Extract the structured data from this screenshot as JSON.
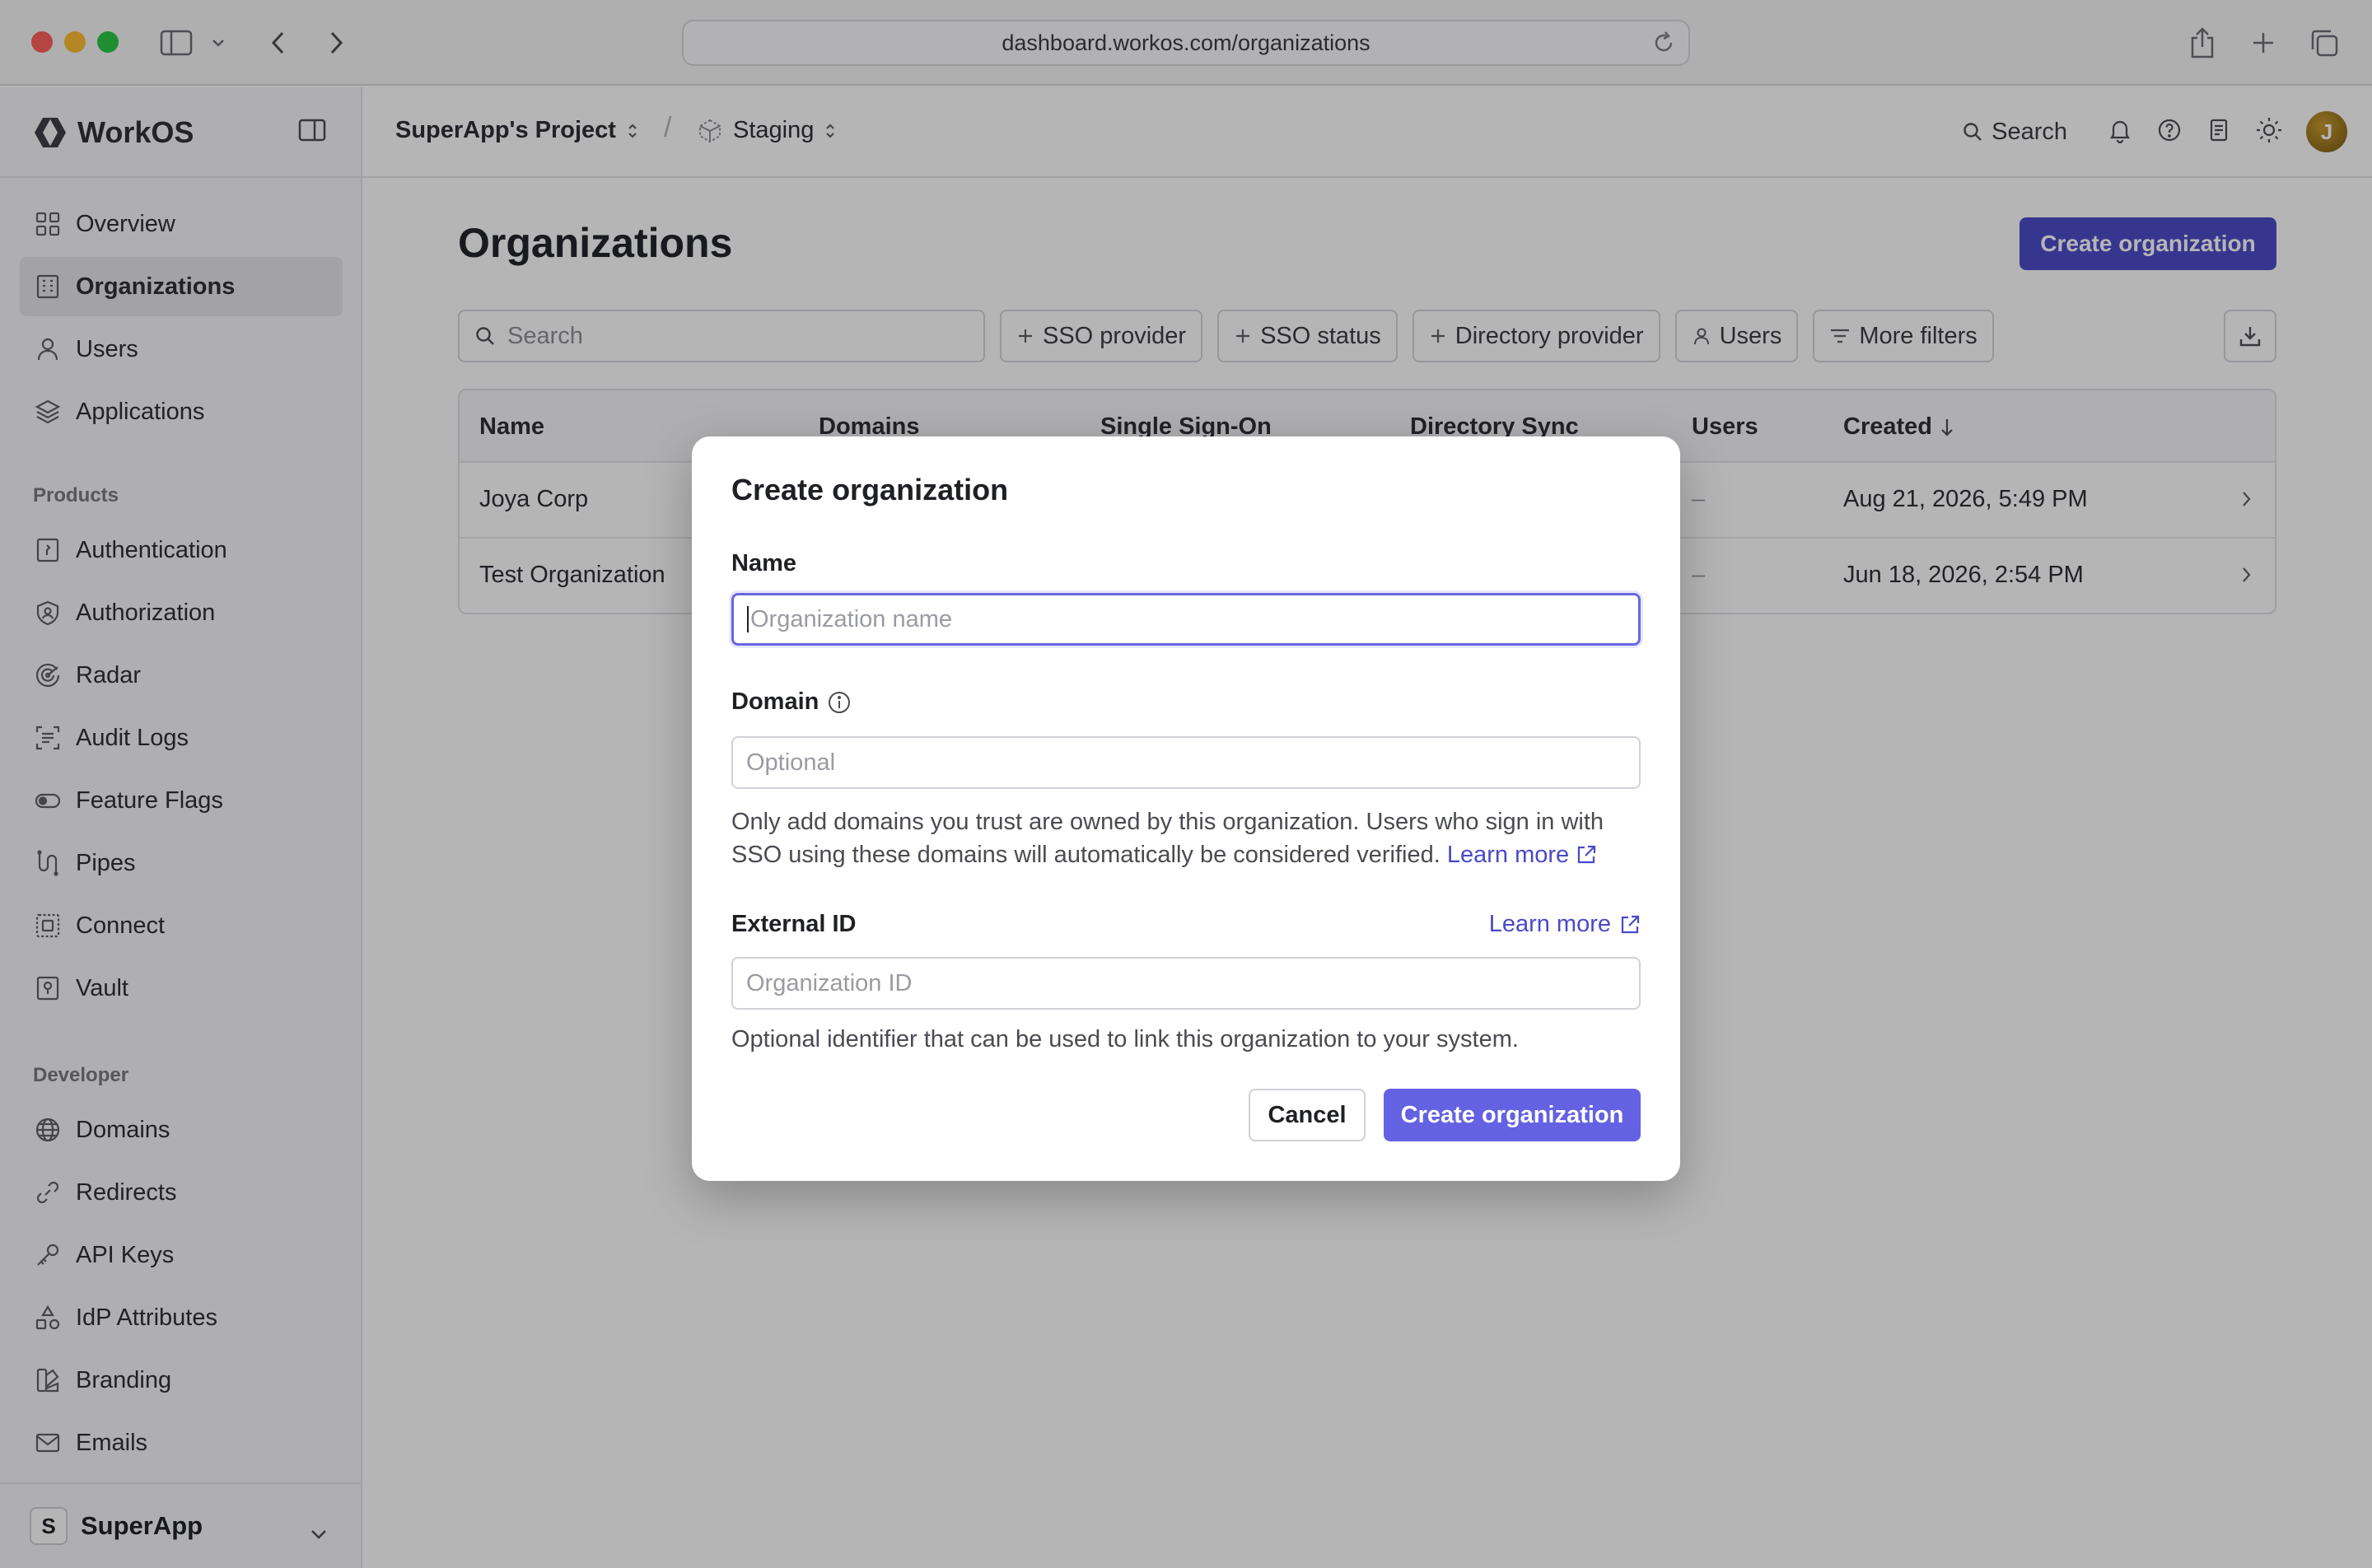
{
  "browser": {
    "url": "dashboard.workos.com/organizations"
  },
  "brand": {
    "name": "WorkOS"
  },
  "breadcrumb": {
    "project": "SuperApp's Project",
    "separator": "/",
    "environment": "Staging"
  },
  "header": {
    "search_label": "Search",
    "avatar_initial": "J"
  },
  "sidebar": {
    "top_items": [
      {
        "label": "Overview"
      },
      {
        "label": "Organizations"
      },
      {
        "label": "Users"
      },
      {
        "label": "Applications"
      }
    ],
    "products_label": "Products",
    "product_items": [
      {
        "label": "Authentication"
      },
      {
        "label": "Authorization"
      },
      {
        "label": "Radar"
      },
      {
        "label": "Audit Logs"
      },
      {
        "label": "Feature Flags"
      },
      {
        "label": "Pipes"
      },
      {
        "label": "Connect"
      },
      {
        "label": "Vault"
      }
    ],
    "developer_label": "Developer",
    "developer_items": [
      {
        "label": "Domains"
      },
      {
        "label": "Redirects"
      },
      {
        "label": "API Keys"
      },
      {
        "label": "IdP Attributes"
      },
      {
        "label": "Branding"
      },
      {
        "label": "Emails"
      }
    ],
    "org_switcher": {
      "initial": "S",
      "name": "SuperApp"
    }
  },
  "main": {
    "title": "Organizations",
    "create_button": "Create organization",
    "search_placeholder": "Search",
    "filters": {
      "sso_provider": "SSO provider",
      "sso_status": "SSO status",
      "directory_provider": "Directory provider",
      "users": "Users",
      "more_filters": "More filters"
    },
    "table": {
      "headers": {
        "name": "Name",
        "domains": "Domains",
        "sso": "Single Sign-On",
        "directory_sync": "Directory Sync",
        "users": "Users",
        "created": "Created"
      },
      "rows": [
        {
          "name": "Joya Corp",
          "users": "–",
          "created": "Aug 21, 2026, 5:49 PM"
        },
        {
          "name": "Test Organization",
          "users": "–",
          "created": "Jun 18, 2026, 2:54 PM"
        }
      ]
    }
  },
  "modal": {
    "title": "Create organization",
    "name_label": "Name",
    "name_placeholder": "Organization name",
    "domain_label": "Domain",
    "domain_placeholder": "Optional",
    "domain_help": "Only add domains you trust are owned by this organization. Users who sign in with SSO using these domains will automatically be considered verified.",
    "domain_learn_more": "Learn more",
    "external_id_label": "External ID",
    "external_id_learn_more": "Learn more",
    "external_id_placeholder": "Organization ID",
    "external_id_help": "Optional identifier that can be used to link this organization to your system.",
    "cancel_button": "Cancel",
    "create_button": "Create organization"
  },
  "colors": {
    "accent": "#4b49c8",
    "modal_primary": "#6462e2"
  }
}
